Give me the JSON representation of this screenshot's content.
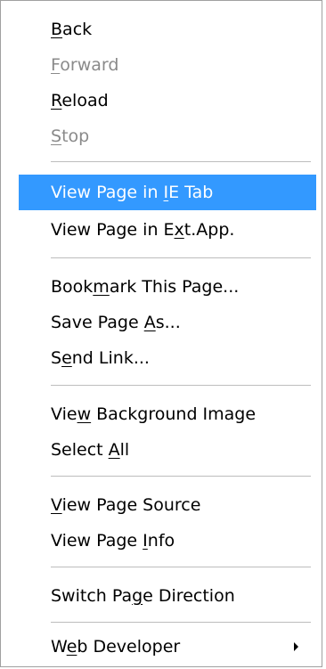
{
  "menu": {
    "items": [
      {
        "pre": "",
        "key": "B",
        "post": "ack",
        "disabled": true
      },
      {
        "pre": "",
        "key": "F",
        "post": "orward",
        "disabled": true
      },
      {
        "pre": "",
        "key": "R",
        "post": "eload",
        "disabled": false
      },
      {
        "pre": "",
        "key": "S",
        "post": "top",
        "disabled": true
      },
      {
        "pre": "View Page in ",
        "key": "I",
        "post": "E Tab",
        "highlighted": true
      },
      {
        "pre": "View Page in E",
        "key": "x",
        "post": "t.App."
      },
      {
        "pre": "Book",
        "key": "m",
        "post": "ark This Page..."
      },
      {
        "pre": "Save Page ",
        "key": "A",
        "post": "s..."
      },
      {
        "pre": "S",
        "key": "e",
        "post": "nd Link..."
      },
      {
        "pre": "Vie",
        "key": "w",
        "post": " Background Image"
      },
      {
        "pre": "Select ",
        "key": "A",
        "post": "ll"
      },
      {
        "pre": "",
        "key": "V",
        "post": "iew Page Source"
      },
      {
        "pre": "View Page ",
        "key": "I",
        "post": "nfo"
      },
      {
        "pre": "Switch Pa",
        "key": "g",
        "post": "e Direction"
      },
      {
        "pre": "W",
        "key": "e",
        "post": "b Developer",
        "has_submenu": true
      }
    ]
  },
  "colors": {
    "highlight": "#3399ff",
    "highlight_text": "#ffffff",
    "disabled_text": "#8a8a8a",
    "separator": "#bdbdbd"
  },
  "icons": {
    "submenu_arrow": "submenu-arrow-icon"
  }
}
